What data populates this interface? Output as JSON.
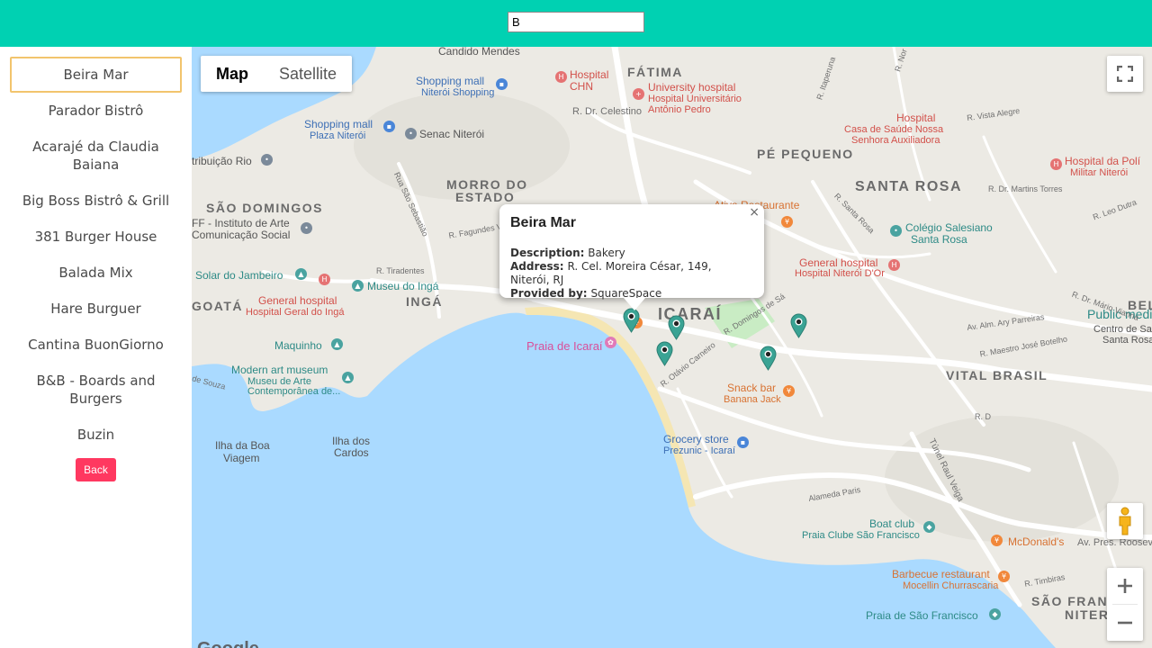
{
  "search": {
    "value": "B"
  },
  "sidebar": {
    "items": [
      "Beira Mar",
      "Parador Bistrô",
      "Acarajé da Claudia Baiana",
      "Big Boss Bistrô & Grill",
      "381 Burger House",
      "Balada Mix",
      "Hare Burguer",
      "Cantina BuonGiorno",
      "B&B - Boards and Burgers",
      "Buzin"
    ],
    "back_label": "Back"
  },
  "map": {
    "type_map": "Map",
    "type_satellite": "Satellite",
    "icons": {
      "fullscreen": "fullscreen-icon",
      "pegman": "pegman-icon",
      "zoom_in": "plus-icon",
      "zoom_out": "minus-icon",
      "close": "close-icon"
    },
    "colors": {
      "water": "#aadaff",
      "land": "#eceae4",
      "park": "#c9ecc4",
      "marker": "#3aa394",
      "sand": "#f5e6b3"
    },
    "labels": {
      "candido_mendes": "Candido Mendes",
      "fatima": "FÁTIMA",
      "hospital_chn": "Hospital",
      "hospital_chn2": "CHN",
      "univ_hospital": "University hospital",
      "univ_hospital2": "Hospital Universitário",
      "univ_hospital3": "Antônio Pedro",
      "shopping1": "Shopping mall",
      "shopping1b": "Niterói Shopping",
      "r_celestino": "R. Dr. Celestino",
      "shopping2": "Shopping mall",
      "shopping2b": "Plaza Niterói",
      "senac": "Senac Niterói",
      "hospital_csn": "Hospital",
      "hospital_csn2": "Casa de Saúde Nossa",
      "hospital_csn3": "Senhora Auxiliadora",
      "pe_pequeno": "PÉ PEQUENO",
      "hospital_pm": "Hospital da Polí",
      "hospital_pm2": "Militar Niterói",
      "tribuicao": "tribuição Rio",
      "morro": "MORRO DO",
      "morro2": "ESTADO",
      "sao_domingos": "SÃO DOMINGOS",
      "santa_rosa": "SANTA ROSA",
      "atiya": "Atiya Restaurante",
      "colegio": "Colégio Salesiano",
      "colegio2": "Santa Rosa",
      "iff": "FF - Instituto de Arte",
      "iff2": "Comunicação Social",
      "general_hospital_nd": "General hospital",
      "general_hospital_nd2": "Hospital Niterói D'Or",
      "solar": "Solar do Jambeiro",
      "museu_inga": "Museu do Ingá",
      "goata": "GOATÁ",
      "general_hospital_inga": "General hospital",
      "general_hospital_inga2": "Hospital Geral do Ingá",
      "inga": "INGÁ",
      "icarai": "ICARAÍ",
      "public_med": "Public medical center",
      "public_med2": "Centro de Saúde",
      "public_med3": "Santa Rosa",
      "belt": "BELT",
      "praia_icarai": "Praia de Icaraí",
      "maquinho": "Maquinho",
      "modern_art": "Modern art museum",
      "modern_art2": "Museu de Arte",
      "modern_art3": "Contemporânea de...",
      "vital_brasil": "VITAL BRASIL",
      "snack_bar": "Snack bar",
      "snack_bar2": "Banana Jack",
      "grocery": "Grocery store",
      "grocery2": "Prezunic - Icaraí",
      "ilha_boa": "Ilha da Boa",
      "ilha_boa2": "Viagem",
      "ilha_cardos": "Ilha dos",
      "ilha_cardos2": "Cardos",
      "tunel": "Túnel Raul Veiga",
      "boat_club": "Boat club",
      "boat_club2": "Praia Clube São Francisco",
      "mcdonalds": "McDonald's",
      "av_pres": "Av. Pres. Roosev",
      "bbq": "Barbecue restaurant",
      "bbq2": "Mocellin Churrascaria",
      "sao_fran": "SÃO FRAN",
      "niter": "NITER",
      "praia_sf": "Praia de São Francisco",
      "google": "Google",
      "st_sousa": "de Souza",
      "st_sebastiao": "Rua São Sebastião",
      "st_fagundes": "R. Fagundes Varela",
      "st_tiradentes": "R. Tiradentes",
      "st_otavio": "R. Otávio Carneiro",
      "st_domingos": "R. Domingos de Sá",
      "st_maestro": "R. Maestro José Botelho",
      "st_mario": "R. Dr. Mário Vianna",
      "st_ary": "Av. Alm. Ary Parreiras",
      "st_martins": "R. Dr. Martins Torres",
      "st_alegre": "R. Vista Alegre",
      "st_santarosa": "R. Santa Rosa",
      "st_alameda": "Alameda Paris",
      "st_timbiras": "R. Timbiras",
      "st_d": "R. D",
      "st_leao": "R. Leo Dutra",
      "st_ita": "R. Itaperuna",
      "st_noronha": "R. Nor"
    }
  },
  "info": {
    "title": "Beira Mar",
    "description_label": "Description:",
    "description": "Bakery",
    "address_label": "Address:",
    "address": "R. Cel. Moreira César, 149, Niterói, RJ",
    "provider_label": "Provided by:",
    "provider": "SquareSpace",
    "close": "×"
  }
}
